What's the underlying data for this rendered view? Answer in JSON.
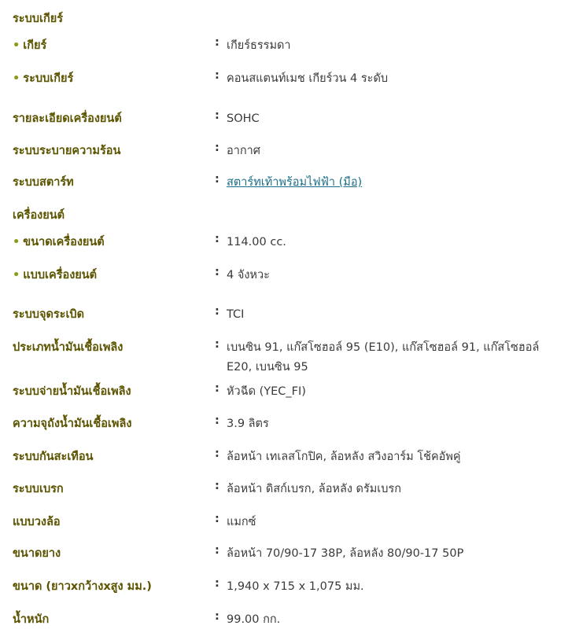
{
  "spec": {
    "gear_section": "ระบบเกียร์",
    "gear_label": "เกียร์",
    "gear_value": "เกียร์ธรรมดา",
    "gear_system_label": "ระบบเกียร์",
    "gear_system_value": "คอนสแตนท์เมช เกียร์วน 4 ระดับ",
    "engine_detail_label": "รายละเอียดเครื่องยนต์",
    "engine_detail_value": "SOHC",
    "cooling_label": "ระบบระบายความร้อน",
    "cooling_value": "อากาศ",
    "starter_label": "ระบบสตาร์ท",
    "starter_value": "สตาร์ทเท้าพร้อมไฟฟ้า (มือ)",
    "engine_section": "เครื่องยนต์",
    "engine_size_label": "ขนาดเครื่องยนต์",
    "engine_size_value": "114.00 cc.",
    "engine_type_label": "แบบเครื่องยนต์",
    "engine_type_value": "4 จังหวะ",
    "ignition_label": "ระบบจุดระเบิด",
    "ignition_value": "TCI",
    "fuel_type_label": "ประเภทน้ำมันเชื้อเพลิง",
    "fuel_type_value_line1": "เบนซิน 91, แก๊สโซฮอล์ 95 (E10), แก๊สโซฮอล์ 91, แก๊สโซฮอล์",
    "fuel_type_value_line2": "E20, เบนซิน 95",
    "fuel_supply_label": "ระบบจ่ายน้ำมันเชื้อเพลิง",
    "fuel_supply_value": "หัวฉีด (YEC_FI)",
    "fuel_capacity_label": "ความจุถังน้ำมันเชื้อเพลิง",
    "fuel_capacity_value": "3.9 ลิตร",
    "suspension_label": "ระบบกันสะเทือน",
    "suspension_value": "ล้อหน้า เทเลสโกปิค, ล้อหลัง สวิงอาร์ม โช้คอัพคู่",
    "brake_label": "ระบบเบรก",
    "brake_value": "ล้อหน้า ดิสก์เบรก, ล้อหลัง ดรัมเบรก",
    "wheel_label": "แบบวงล้อ",
    "wheel_value": "แมกซ์",
    "tire_label": "ขนาดยาง",
    "tire_value": "ล้อหน้า 70/90-17 38P, ล้อหลัง 80/90-17 50P",
    "dimension_label": "ขนาด (ยาวxกว้างxสูง มม.)",
    "dimension_value": "1,940 x 715 x 1,075 มม.",
    "weight_label": "น้ำหนัก",
    "weight_value": "99.00 กก.",
    "colon": ":",
    "bullet": "•"
  }
}
